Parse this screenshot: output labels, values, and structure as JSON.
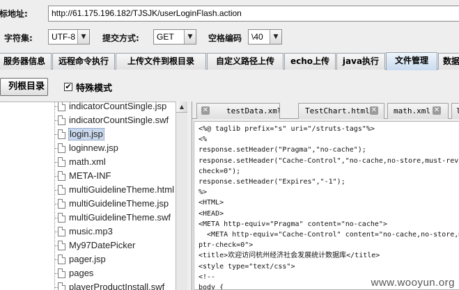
{
  "url_bar": {
    "label": "目标地址:",
    "value": "http://61.175.196.182/TJSJK/userLoginFlash.action"
  },
  "options": {
    "charset_label": "字符集:",
    "charset_value": "UTF-8",
    "method_label": "提交方式:",
    "method_value": "GET",
    "space_label": "空格编码",
    "space_value": "\\40"
  },
  "tabs": [
    {
      "label": "服务器信息"
    },
    {
      "label": "远程命令执行"
    },
    {
      "label": "上传文件到根目录"
    },
    {
      "label": "自定义路径上传"
    },
    {
      "label": "echo上传"
    },
    {
      "label": "java执行"
    },
    {
      "label": "文件管理"
    },
    {
      "label": "数据"
    }
  ],
  "file_manager": {
    "list_root_button": "列根目录",
    "special_mode_label": "特殊模式",
    "special_mode_checked": true,
    "files": [
      {
        "name": "indicatorCountSingle.jsp"
      },
      {
        "name": "indicatorCountSingle.swf"
      },
      {
        "name": "login.jsp",
        "selected": true
      },
      {
        "name": "loginnew.jsp"
      },
      {
        "name": "math.xml"
      },
      {
        "name": "META-INF"
      },
      {
        "name": "multiGuidelineTheme.html"
      },
      {
        "name": "multiGuidelineTheme.jsp"
      },
      {
        "name": "multiGuidelineTheme.swf"
      },
      {
        "name": "music.mp3"
      },
      {
        "name": "My97DatePicker"
      },
      {
        "name": "pager.jsp"
      },
      {
        "name": "pages"
      },
      {
        "name": "playerProductInstall.swf"
      }
    ]
  },
  "editor": {
    "tabs": [
      {
        "name": "testData.xml"
      },
      {
        "name": "TestChart.html"
      },
      {
        "name": "math.xml"
      },
      {
        "name": "l"
      }
    ],
    "code_lines": [
      "<%@ taglib prefix=\"s\" uri=\"/struts-tags\"%>",
      "<%",
      "response.setHeader(\"Pragma\",\"no-cache\");",
      "response.setHeader(\"Cache-Control\",\"no-cache,no-store,must-reva",
      "check=0\");",
      "response.setHeader(\"Expires\",\"-1\");",
      "%>",
      "<HTML>",
      "<HEAD>",
      "<META http-equiv=\"Pragma\" content=\"no-cache\">",
      "  <META http-equiv=\"Cache-Control\" content=\"no-cache,no-store,m",
      "ptr-check=0\">",
      "<title>欢迎访问杭州经济社会发展统计数据库</title>",
      "<style type=\"text/css\">",
      "<!--",
      "body {"
    ]
  },
  "watermark": "www.wooyun.org"
}
